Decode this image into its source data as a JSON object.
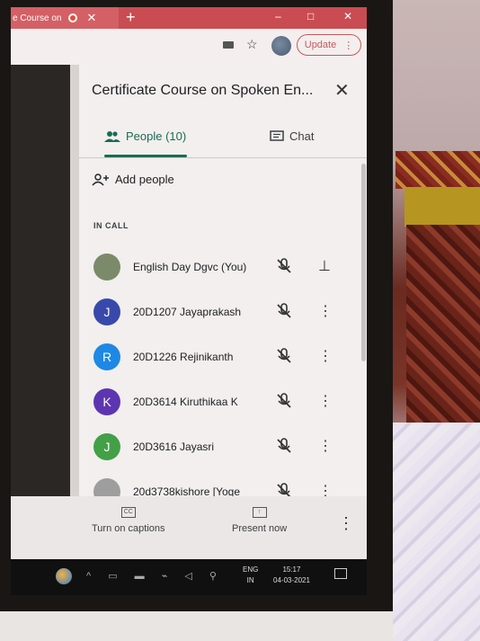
{
  "browser": {
    "tab_title": "e Course on",
    "new_tab": "+",
    "minimize": "–",
    "maximize": "□",
    "close": "✕",
    "update_label": "Update"
  },
  "panel": {
    "title": "Certificate Course on Spoken En...",
    "tabs": {
      "people_label": "People (10)",
      "chat_label": "Chat"
    },
    "add_people_label": "Add people",
    "section_label": "IN CALL",
    "participants": [
      {
        "name": "English Day Dgvc (You)",
        "initial": "",
        "color": "#7b8a6a"
      },
      {
        "name": "20D1207 Jayaprakash",
        "initial": "J",
        "color": "#3949ab"
      },
      {
        "name": "20D1226 Rejinikanth",
        "initial": "R",
        "color": "#1e88e5"
      },
      {
        "name": "20D3614 Kiruthikaa K",
        "initial": "K",
        "color": "#5e35b1"
      },
      {
        "name": "20D3616 Jayasri",
        "initial": "J",
        "color": "#43a047"
      },
      {
        "name": "20d3738kishore [Yoge",
        "initial": "",
        "color": "#9e9e9e"
      }
    ]
  },
  "bottom_bar": {
    "captions_label": "Turn on captions",
    "present_label": "Present now"
  },
  "taskbar": {
    "lang_top": "ENG",
    "lang_bottom": "IN",
    "time": "15:17",
    "date": "04-03-2021"
  }
}
